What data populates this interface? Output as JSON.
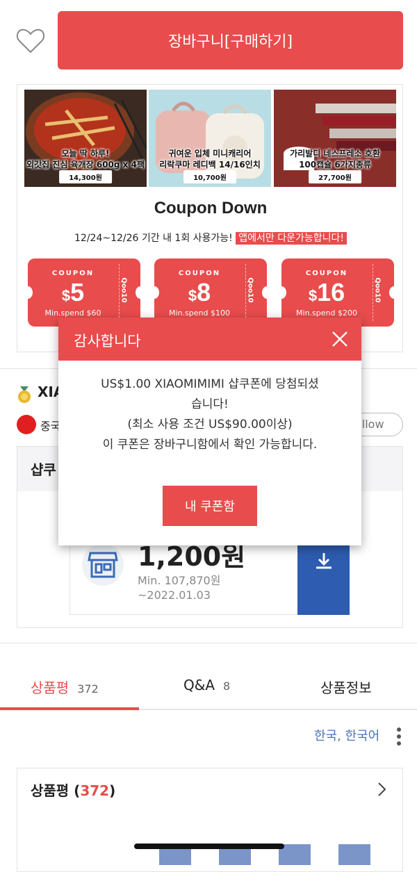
{
  "header": {
    "cart_label": "장바구니[구매하기]"
  },
  "banner": {
    "products": [
      {
        "caption_1": "오늘 딱 하루!",
        "caption_2": "외갓집 진심 육개장 600g x 4팩",
        "price": "14,300원"
      },
      {
        "caption_1": "귀여운 입체 미니캐리어",
        "caption_2": "리락쿠마 레디백 14/16인치",
        "price": "10,700원"
      },
      {
        "caption_1": "가리발디 네스프레소 호환",
        "caption_2": "100캡슐 6가지종류",
        "price": "27,700원"
      }
    ],
    "title": "Coupon Down",
    "subtitle": "12/24~12/26 기간 내 1회 사용가능!",
    "subtitle_highlight": "앱에서만 다운가능합니다!",
    "coupons": [
      {
        "label": "COUPON",
        "currency": "$",
        "amount": "5",
        "min": "Min.spend $60",
        "brand": "Qoo10"
      },
      {
        "label": "COUPON",
        "currency": "$",
        "amount": "8",
        "min": "Min.spend $100",
        "brand": "Qoo10"
      },
      {
        "label": "COUPON",
        "currency": "$",
        "amount": "16",
        "min": "Min.spend $200",
        "brand": "Qoo10"
      }
    ]
  },
  "shop": {
    "name": "XIA",
    "country": "중국",
    "follow_label": "ollow",
    "coupon_section_title": "샵쿠",
    "coupon": {
      "amount": "1,200원",
      "min": "Min. 107,870원",
      "expiry": "~2022.01.03"
    }
  },
  "tabs": [
    {
      "label": "상품평",
      "count": "372"
    },
    {
      "label": "Q&A",
      "count": "8"
    },
    {
      "label": "상품정보",
      "count": ""
    }
  ],
  "language": "한국, 한국어",
  "reviews": {
    "title": "상품평",
    "count": "372"
  },
  "modal": {
    "title": "감사합니다",
    "line1": "US$1.00 XIAOMIMIMI 샵쿠폰에 당첨되셨",
    "line2": "습니다!",
    "line3": "(최소 사용 조건 US$90.00이상)",
    "line4": "이 쿠폰은 장바구니함에서 확인 가능합니다.",
    "button": "내 쿠폰함"
  },
  "colors": {
    "accent": "#e84c4c",
    "download": "#2d5cb0",
    "link": "#4a74b8"
  }
}
